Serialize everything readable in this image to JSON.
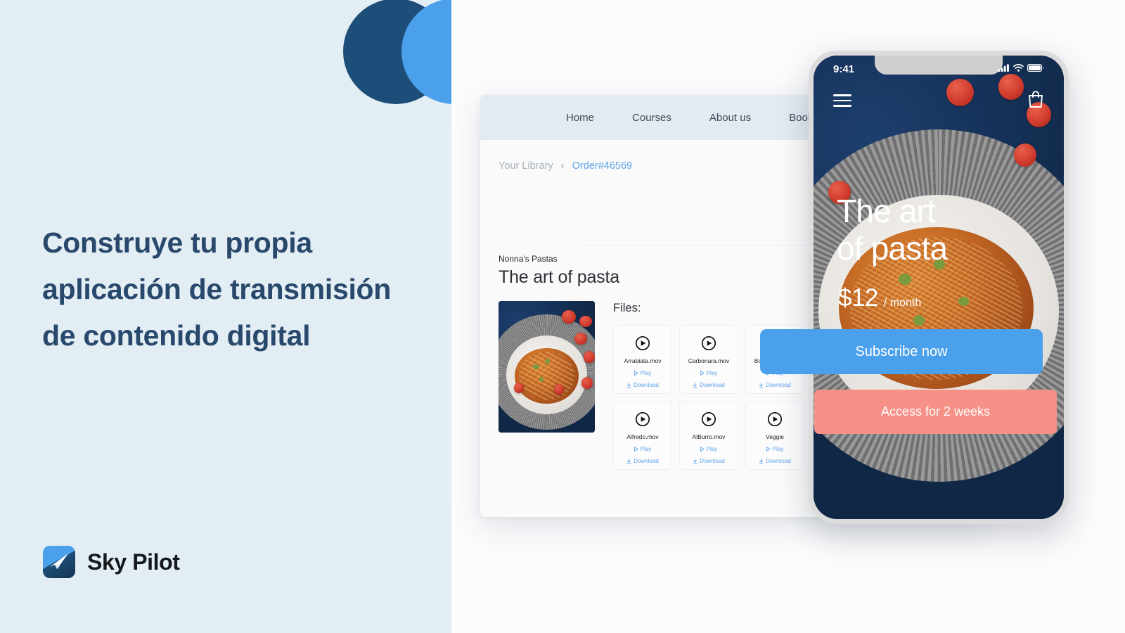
{
  "left": {
    "headline": "Construye tu propia aplicación de transmisión de contenido digital",
    "brand_name": "Sky Pilot",
    "colors": {
      "background": "#e3edf4",
      "headline_text": "#28496c",
      "circle_dark": "#1d4e79",
      "circle_light": "#4ba0eb"
    }
  },
  "app": {
    "nav_items": [
      {
        "label": "Home"
      },
      {
        "label": "Courses"
      },
      {
        "label": "About us"
      },
      {
        "label": "Books"
      }
    ],
    "breadcrumb": {
      "parent": "Your Library",
      "separator": "‹",
      "current": "Order#46569"
    },
    "eyebrow": "Nonna's Pastas",
    "title": "The art of pasta",
    "files_label": "Files:",
    "file_action_play": "Play",
    "file_action_download": "Download",
    "files": [
      {
        "name": "Arrabiata.mov"
      },
      {
        "name": "Carbonara.mov"
      },
      {
        "name": "Bolognese.mov"
      },
      {
        "name": "Alfredo.mov"
      },
      {
        "name": "AlBurro.mov"
      },
      {
        "name": "Veggie"
      }
    ],
    "colors": {
      "nav_background": "#e3eaf0",
      "card_background": "#fafafa",
      "link": "#5fa3e8"
    }
  },
  "phone": {
    "status_time": "9:41",
    "hero_title_line1": "The art",
    "hero_title_line2": "of pasta",
    "price_amount": "$12",
    "price_period": "/ month",
    "subscribe_label": "Subscribe now",
    "access_label": "Access for 2 weeks",
    "colors": {
      "subscribe": "#4ba0eb",
      "access": "#f79086"
    }
  }
}
